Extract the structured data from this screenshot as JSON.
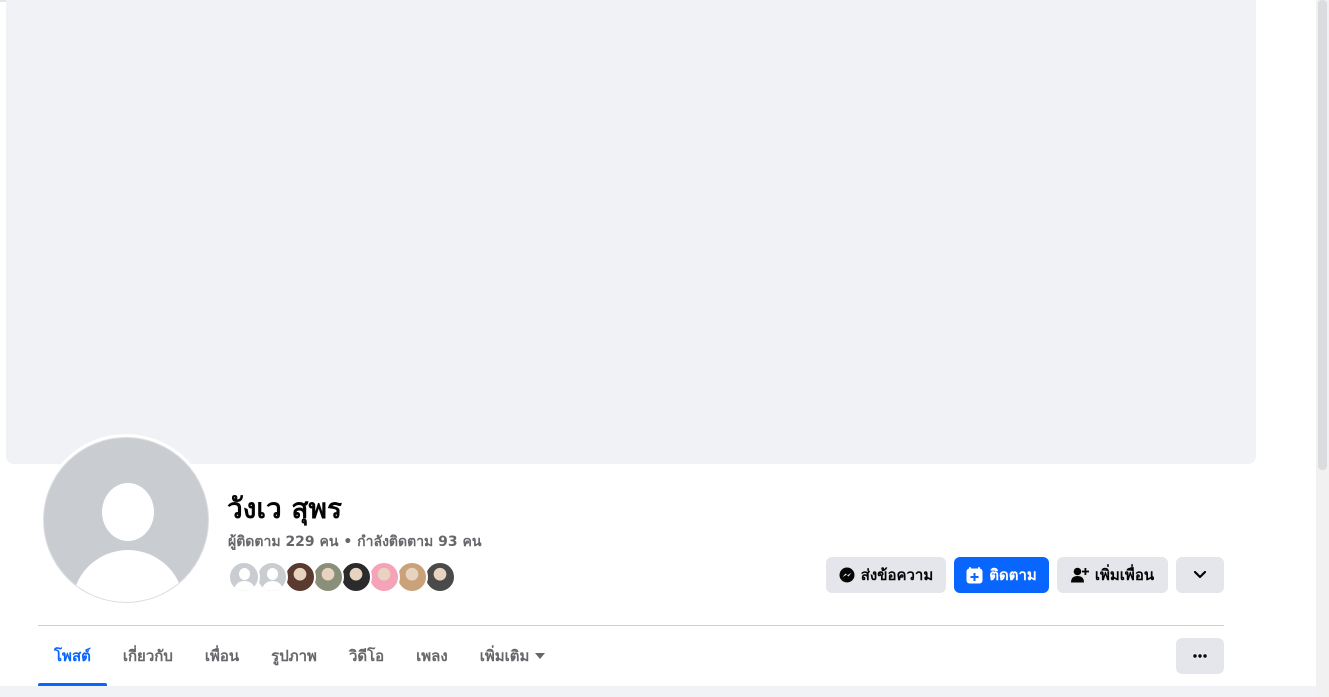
{
  "profile": {
    "name": "วังเว สุพร",
    "stats": "ผู้ติดตาม 229 คน • กำลังติดตาม 93 คน"
  },
  "friends_preview": [
    {
      "type": "default",
      "color": "#c9ccd1"
    },
    {
      "type": "default",
      "color": "#c9ccd1"
    },
    {
      "type": "photo",
      "color": "#5a3a2e"
    },
    {
      "type": "photo",
      "color": "#8a8f7a"
    },
    {
      "type": "photo",
      "color": "#2b2b2b"
    },
    {
      "type": "photo",
      "color": "#f4a3b8"
    },
    {
      "type": "photo",
      "color": "#c9a27a"
    },
    {
      "type": "photo",
      "color": "#4a4a4a"
    }
  ],
  "actions": {
    "message_label": "ส่งข้อความ",
    "follow_label": "ติดตาม",
    "add_friend_label": "เพิ่มเพื่อน"
  },
  "tabs": [
    {
      "label": "โพสต์",
      "active": true
    },
    {
      "label": "เกี่ยวกับ",
      "active": false
    },
    {
      "label": "เพื่อน",
      "active": false
    },
    {
      "label": "รูปภาพ",
      "active": false
    },
    {
      "label": "วิดีโอ",
      "active": false
    },
    {
      "label": "เพลง",
      "active": false
    },
    {
      "label": "เพิ่มเติม",
      "active": false
    }
  ],
  "colors": {
    "accent": "#0866ff",
    "cover": "#f0f2f5",
    "button_gray": "#e4e6eb",
    "text_secondary": "#65676b"
  },
  "icons": {
    "message": "messenger-icon",
    "follow": "follow-plus-icon",
    "add_friend": "add-friend-icon",
    "expand": "chevron-down-icon",
    "more": "more-dots-icon",
    "tab_more": "caret-down-icon"
  }
}
